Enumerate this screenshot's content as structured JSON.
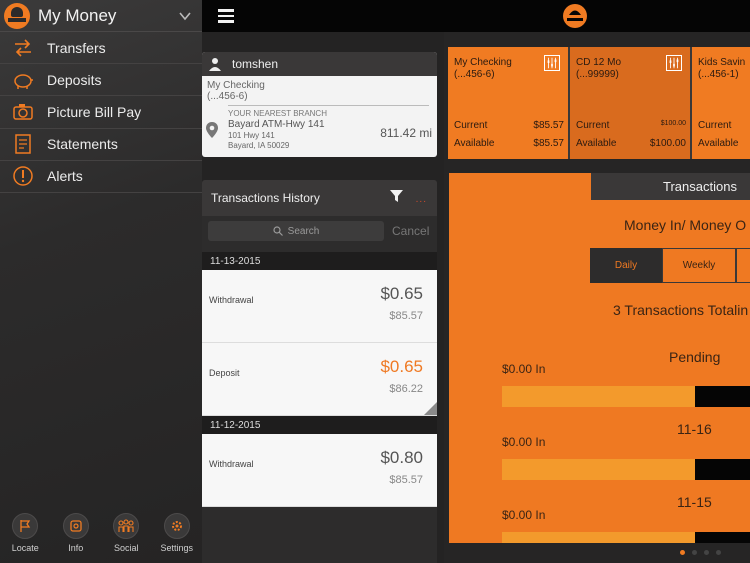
{
  "sidebar": {
    "title": "My Money",
    "items": [
      {
        "label": "Transfers",
        "icon": "transfer-arrows-icon"
      },
      {
        "label": "Deposits",
        "icon": "piggy-bank-icon"
      },
      {
        "label": "Picture Bill Pay",
        "icon": "camera-icon"
      },
      {
        "label": "Statements",
        "icon": "document-icon"
      },
      {
        "label": "Alerts",
        "icon": "alert-circle-icon"
      }
    ],
    "bottom": [
      {
        "label": "Locate",
        "icon": "flag-icon"
      },
      {
        "label": "Info",
        "icon": "info-icon"
      },
      {
        "label": "Social",
        "icon": "people-icon"
      },
      {
        "label": "Settings",
        "icon": "gears-icon"
      }
    ]
  },
  "account_card": {
    "user": "tomshen",
    "account_name": "My Checking",
    "account_number": "(...456-6)",
    "branch_heading": "YOUR NEAREST BRANCH",
    "branch_name": "Bayard ATM-Hwy 141",
    "branch_address": "101 Hwy 141",
    "branch_city": "Bayard, IA  50029",
    "distance": "811.42 mi"
  },
  "history": {
    "title": "Transactions History",
    "dots": "...",
    "search_placeholder": "Search",
    "cancel_label": "Cancel",
    "groups": [
      {
        "date": "11-13-2015",
        "rows": [
          {
            "kind": "Withdrawal",
            "amount": "$0.65",
            "balance": "$85.57"
          },
          {
            "kind": "Deposit",
            "amount": "$0.65",
            "balance": "$86.22"
          }
        ]
      },
      {
        "date": "11-12-2015",
        "rows": [
          {
            "kind": "Withdrawal",
            "amount": "$0.80",
            "balance": "$85.57"
          }
        ]
      }
    ]
  },
  "tiles": [
    {
      "name": "My Checking",
      "number": "(...456-6)",
      "current_label": "Current",
      "current": "$85.57",
      "available_label": "Available",
      "available": "$85.57"
    },
    {
      "name": "CD 12 Mo",
      "number": "(...99999)",
      "current_label": "Current",
      "current": "$100.00",
      "available_label": "Available",
      "available": "$100.00"
    },
    {
      "name": "Kids Savin",
      "number": "(...456-1)",
      "current_label": "Current",
      "current": "",
      "available_label": "Available",
      "available": ""
    }
  ],
  "transactions": {
    "tab_label": "Transactions",
    "heading": "Money In/ Money O",
    "periods": [
      "Daily",
      "Weekly"
    ],
    "summary": "3 Transactions Totalin",
    "pending_label": "Pending",
    "bars": [
      {
        "label": "$0.00 In",
        "fill": 0.78
      },
      {
        "label": "$0.00 In",
        "fill": 0.78
      },
      {
        "label": "$0.00 In",
        "fill": 0.78
      }
    ],
    "dates": [
      "11-16",
      "11-15"
    ]
  },
  "pager": {
    "pages": 4,
    "active": 0
  },
  "colors": {
    "accent": "#f07b22",
    "dark": "#2d2c2c"
  }
}
